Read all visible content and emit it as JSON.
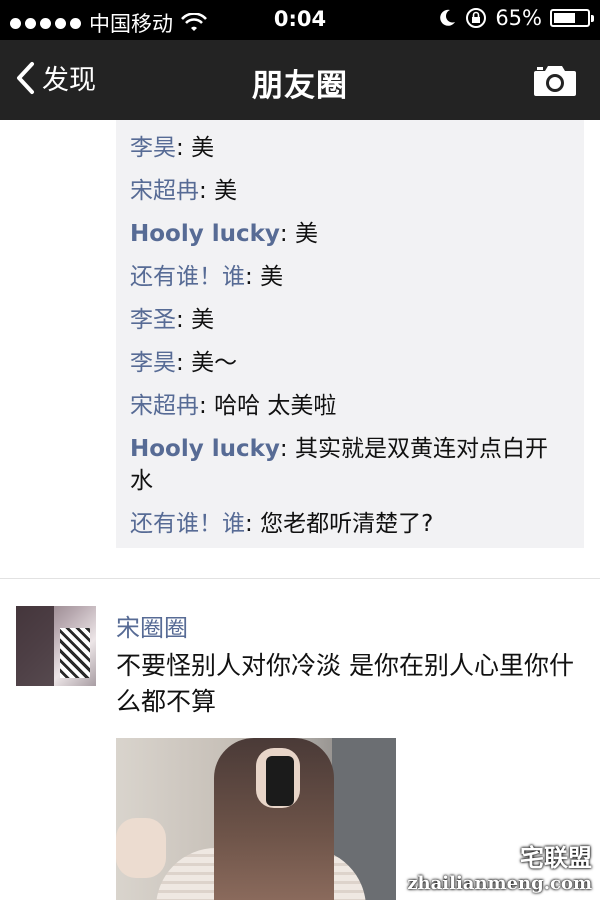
{
  "status_bar": {
    "carrier": "中国移动",
    "time": "0:04",
    "battery": "65%",
    "battery_level": 0.65
  },
  "nav": {
    "back_label": "发现",
    "title": "朋友圈"
  },
  "comments": [
    {
      "name": "李昊",
      "sep": ": ",
      "text": "美"
    },
    {
      "name": "宋超冉",
      "sep": ": ",
      "text": "美"
    },
    {
      "name": "Hooly lucky",
      "sep": ": ",
      "text": "美"
    },
    {
      "name": "还有谁！谁",
      "sep": ": ",
      "text": "美"
    },
    {
      "name": "李圣",
      "sep": ": ",
      "text": "美"
    },
    {
      "name": "李昊",
      "sep": ": ",
      "text": "美～"
    },
    {
      "name": "宋超冉",
      "sep": ": ",
      "text": "哈哈 太美啦"
    },
    {
      "name": "Hooly lucky",
      "sep": ": ",
      "text": "其实就是双黄连对点白开水"
    },
    {
      "name": "还有谁！谁",
      "sep": ": ",
      "text": "您老都听清楚了?"
    }
  ],
  "post": {
    "author": "宋圈圈",
    "text": "不要怪别人对你冷淡 是你在别人心里你什么都不算"
  },
  "watermark": {
    "brand": "宅联盟",
    "url": "zhailianmeng.com"
  },
  "colors": {
    "link": "#576b95",
    "nav_bg": "#232323",
    "comment_bg": "#f2f2f4"
  }
}
